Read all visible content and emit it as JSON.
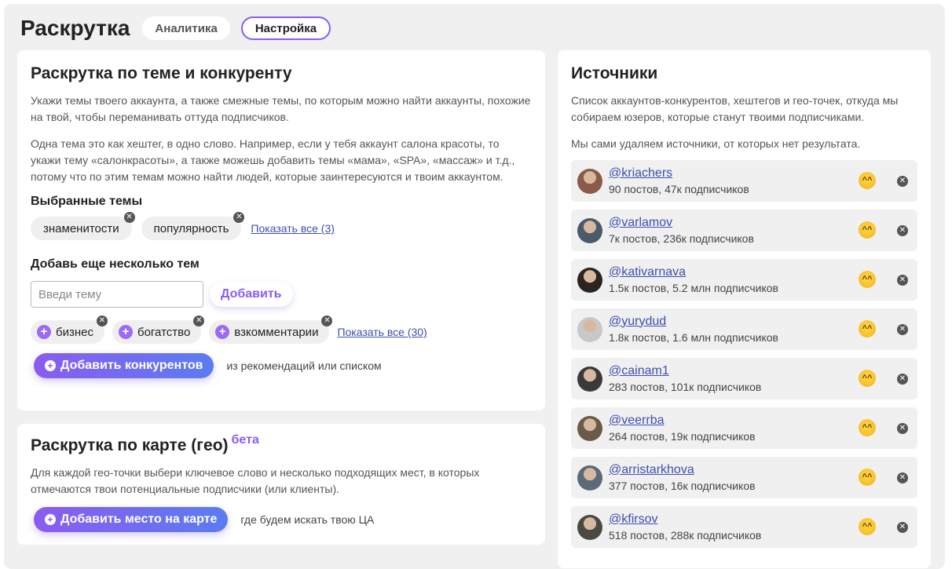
{
  "header": {
    "title": "Раскрутка",
    "tabs": [
      {
        "label": "Аналитика",
        "active": false
      },
      {
        "label": "Настройка",
        "active": true
      }
    ]
  },
  "themes_card": {
    "title": "Раскрутка по теме и конкуренту",
    "paragraph1": "Укажи темы твоего аккаунта, а также смежные темы, по которым можно найти аккаунты, похожие на твой, чтобы переманивать оттуда подписчиков.",
    "paragraph2": "Одна тема это как хештег, в одно слово. Например, если у тебя аккаунт салона красоты, то укажи тему «салонкрасоты», а также можешь добавить темы «мама», «SPA», «массаж» и т.д., потому что по этим темам можно найти людей, которые заинтересуются и твоим аккаунтом.",
    "selected_label": "Выбранные темы",
    "selected_topics": [
      "знаменитости",
      "популярность"
    ],
    "selected_show_all": "Показать все (3)",
    "add_more_label": "Добавь еще несколько тем",
    "input_placeholder": "Введи тему",
    "add_button": "Добавить",
    "suggested_topics": [
      "бизнес",
      "богатство",
      "взкомментарии"
    ],
    "suggested_show_all": "Показать все (30)",
    "add_competitors_button": "Добавить конкурентов",
    "add_competitors_hint": "из рекомендаций или списком"
  },
  "geo_card": {
    "title": "Раскрутка по карте (гео)",
    "badge": "бета",
    "paragraph": "Для каждой гео-точки выбери ключевое слово и несколько подходящих мест, в которых отмечаются твои потенциальные подписчики (или клиенты).",
    "add_place_button": "Добавить место на карте",
    "add_place_hint": "где будем искать твою ЦА"
  },
  "sources_card": {
    "title": "Источники",
    "paragraph1": "Список аккаунтов-конкурентов, хештегов и гео-точек, откуда мы собираем юзеров, которые станут твоими подписчиками.",
    "paragraph2": "Мы сами удаляем источники, от которых нет результата.",
    "sources": [
      {
        "handle": "@kriachers",
        "stats": "90 постов, 47к подписчиков",
        "avatar_color": "#8a5a4a"
      },
      {
        "handle": "@varlamov",
        "stats": "7к постов, 236к подписчиков",
        "avatar_color": "#4b5a6a"
      },
      {
        "handle": "@kativarnava",
        "stats": "1.5к постов, 5.2 млн подписчиков",
        "avatar_color": "#2b2420"
      },
      {
        "handle": "@yurydud",
        "stats": "1.8к постов, 1.6 млн подписчиков",
        "avatar_color": "#c8c8c8"
      },
      {
        "handle": "@cainam1",
        "stats": "283 постов, 101к подписчиков",
        "avatar_color": "#3a3a3a"
      },
      {
        "handle": "@veerrba",
        "stats": "264 постов, 19к подписчиков",
        "avatar_color": "#6a5a48"
      },
      {
        "handle": "@arristarkhova",
        "stats": "377 постов, 16к подписчиков",
        "avatar_color": "#5a6a78"
      },
      {
        "handle": "@kfirsov",
        "stats": "518 постов, 288к подписчиков",
        "avatar_color": "#4a4a44"
      }
    ]
  }
}
